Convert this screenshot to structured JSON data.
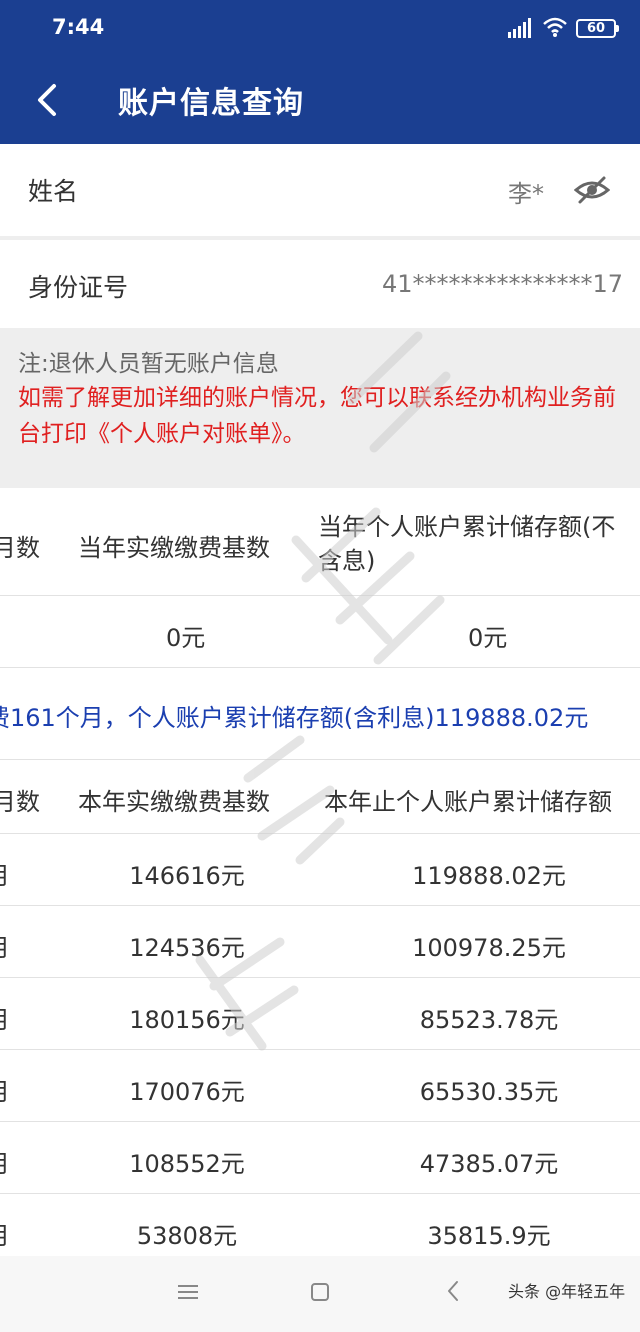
{
  "status": {
    "time": "7:44",
    "battery": "60"
  },
  "header": {
    "title": "账户信息查询"
  },
  "name_row": {
    "label": "姓名",
    "value": "李*"
  },
  "id_row": {
    "label": "身份证号",
    "value": "41***************17"
  },
  "note": {
    "gray": "注:退休人员暂无账户信息",
    "red": "如需了解更加详细的账户情况，您可以联系经办机构业务前台打印《个人账户对账单》。"
  },
  "table1": {
    "headers": [
      "月数",
      "当年实缴缴费基数",
      "当年个人账户累计储存额(不含息)"
    ],
    "row": [
      "",
      "0元",
      "0元"
    ]
  },
  "summary": "费161个月，个人账户累计储存额(含利息)119888.02元",
  "table2": {
    "headers": [
      "月数",
      "本年实缴缴费基数",
      "本年止个人账户累计储存额"
    ],
    "rows": [
      [
        "月",
        "146616元",
        "119888.02元"
      ],
      [
        "月",
        "124536元",
        "100978.25元"
      ],
      [
        "月",
        "180156元",
        "85523.78元"
      ],
      [
        "月",
        "170076元",
        "65530.35元"
      ],
      [
        "月",
        "108552元",
        "47385.07元"
      ],
      [
        "月",
        "53808元",
        "35815.9元"
      ]
    ]
  },
  "footer": {
    "watermark": "头条 @年轻五年"
  },
  "colors": {
    "primary": "#1b3f91",
    "red": "#e02020",
    "blue_text": "#1b3fb0"
  }
}
